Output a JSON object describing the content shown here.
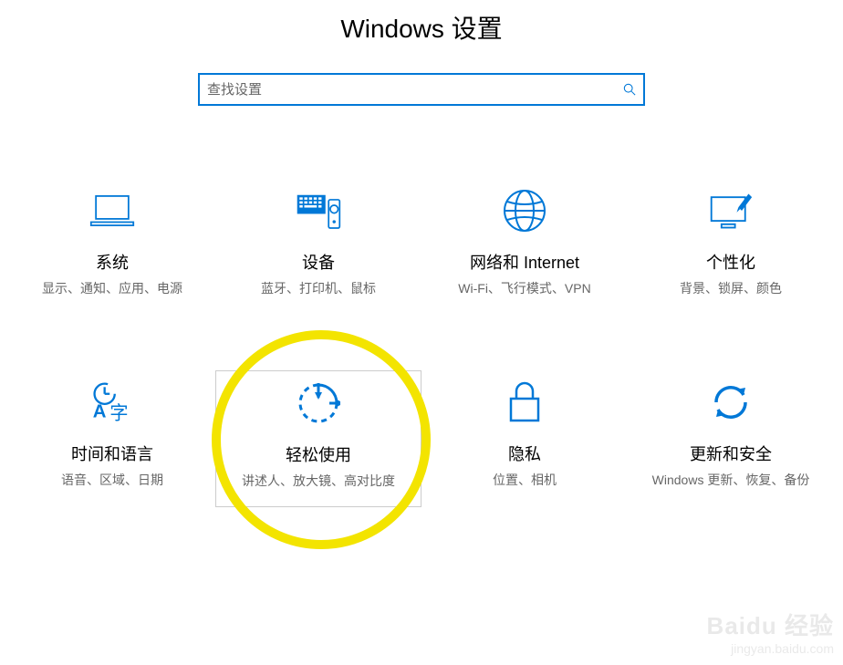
{
  "header": {
    "title": "Windows 设置"
  },
  "search": {
    "placeholder": "查找设置"
  },
  "tiles": {
    "system": {
      "title": "系统",
      "desc": "显示、通知、应用、电源"
    },
    "devices": {
      "title": "设备",
      "desc": "蓝牙、打印机、鼠标"
    },
    "network": {
      "title": "网络和 Internet",
      "desc": "Wi-Fi、飞行模式、VPN"
    },
    "personal": {
      "title": "个性化",
      "desc": "背景、锁屏、颜色"
    },
    "time": {
      "title": "时间和语言",
      "desc": "语音、区域、日期"
    },
    "ease": {
      "title": "轻松使用",
      "desc": "讲述人、放大镜、高对比度"
    },
    "privacy": {
      "title": "隐私",
      "desc": "位置、相机"
    },
    "update": {
      "title": "更新和安全",
      "desc": "Windows 更新、恢复、备份"
    }
  },
  "watermark": {
    "top": "Baidu 经验",
    "bottom": "jingyan.baidu.com"
  },
  "colors": {
    "accent": "#0078d7",
    "highlight": "#f3e400"
  }
}
